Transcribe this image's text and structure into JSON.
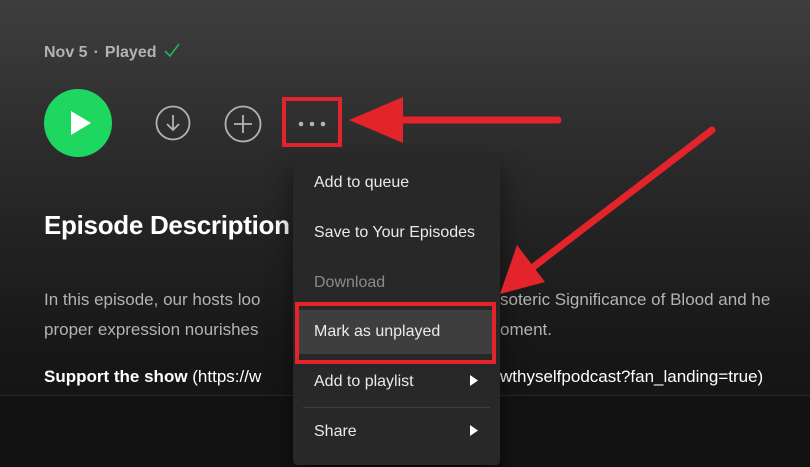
{
  "episode": {
    "date": "Nov 5",
    "separator": "·",
    "status": "Played",
    "status_check_icon": "checkmark-icon"
  },
  "controls": {
    "play_icon": "play-icon",
    "download_icon": "download-icon",
    "add_icon": "plus-icon",
    "more_icon": "more-options-icon"
  },
  "description": {
    "title": "Episode Description",
    "line1_left": "In this episode, our hosts loo",
    "line1_right": "soteric Significance of Blood and he",
    "line2_left": "proper expression nourishes",
    "line2_right": "oment.",
    "support_label": "Support the show",
    "support_left": " (https://w",
    "support_right": "wthyselfpodcast?fan_landing=true)"
  },
  "menu": {
    "items": [
      {
        "label": "Add to queue",
        "disabled": false,
        "submenu": false
      },
      {
        "label": "Save to Your Episodes",
        "disabled": false,
        "submenu": false
      },
      {
        "label": "Download",
        "disabled": true,
        "submenu": false
      },
      {
        "label": "Mark as unplayed",
        "disabled": false,
        "submenu": false,
        "highlighted": true
      },
      {
        "label": "Add to playlist",
        "disabled": false,
        "submenu": true
      },
      {
        "label": "Share",
        "disabled": false,
        "submenu": true
      }
    ],
    "submenu_arrow_icon": "caret-right-icon"
  },
  "colors": {
    "accent_green": "#1ed760",
    "annotation_red": "#e3242b",
    "menu_bg": "#282828"
  }
}
